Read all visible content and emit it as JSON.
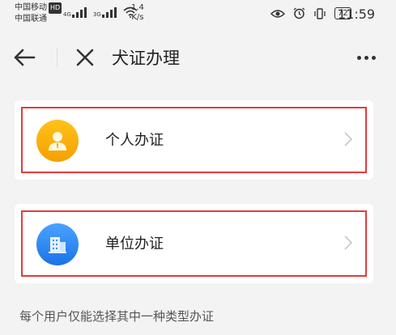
{
  "status_bar": {
    "carrier_1": "中国移动",
    "hd": "HD",
    "carrier_2": "中国联通",
    "net_1": "4G",
    "net_2": "3G",
    "speed_value": "1.4",
    "speed_unit": "K/s",
    "battery": "72",
    "time": "11:59"
  },
  "nav": {
    "title": "犬证办理"
  },
  "options": [
    {
      "label": "个人办证",
      "icon": "person-icon",
      "color": "#f8ad0c"
    },
    {
      "label": "单位办证",
      "icon": "building-icon",
      "color": "#2f8cf5"
    }
  ],
  "note": "每个用户仅能选择其中一种类型办证",
  "colors": {
    "highlight": "#e53a3a",
    "background": "#f3f3f3"
  }
}
